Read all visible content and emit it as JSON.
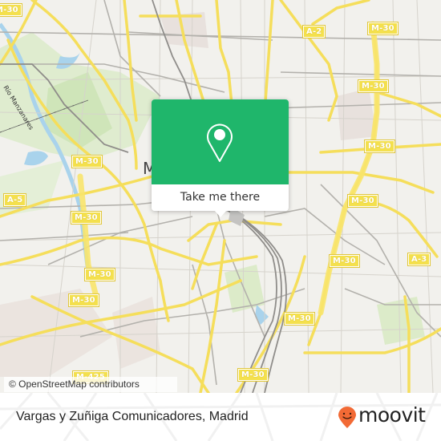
{
  "map": {
    "city_label": "M",
    "river_label": "Río Manzanares",
    "road_shields": [
      {
        "id": "m30-top-left",
        "label": "M-30"
      },
      {
        "id": "m30-left-1",
        "label": "M-30"
      },
      {
        "id": "a5",
        "label": "A-5"
      },
      {
        "id": "m30-left-2",
        "label": "M-30"
      },
      {
        "id": "m30-left-3",
        "label": "M-30"
      },
      {
        "id": "m30-bottom-left",
        "label": "M-30"
      },
      {
        "id": "m425",
        "label": "M-425"
      },
      {
        "id": "a2",
        "label": "A-2"
      },
      {
        "id": "m30-top-right",
        "label": "M-30"
      },
      {
        "id": "m30-right-1",
        "label": "M-30"
      },
      {
        "id": "m30-right-2",
        "label": "M-30"
      },
      {
        "id": "m30-right-3",
        "label": "M-30"
      },
      {
        "id": "a3",
        "label": "A-3"
      },
      {
        "id": "m30-center",
        "label": "M-30"
      },
      {
        "id": "m30-bottom-center",
        "label": "M-30"
      },
      {
        "id": "m30-center-low",
        "label": "M-30"
      }
    ],
    "attribution": "© OpenStreetMap contributors"
  },
  "popup": {
    "icon": "map-pin-icon",
    "button_label": "Take me there",
    "accent_color": "#1fb66b"
  },
  "footer": {
    "place_name": "Vargas y Zuñiga Comunicadores, Madrid",
    "brand": "moovit",
    "brand_color": "#f26a35"
  }
}
